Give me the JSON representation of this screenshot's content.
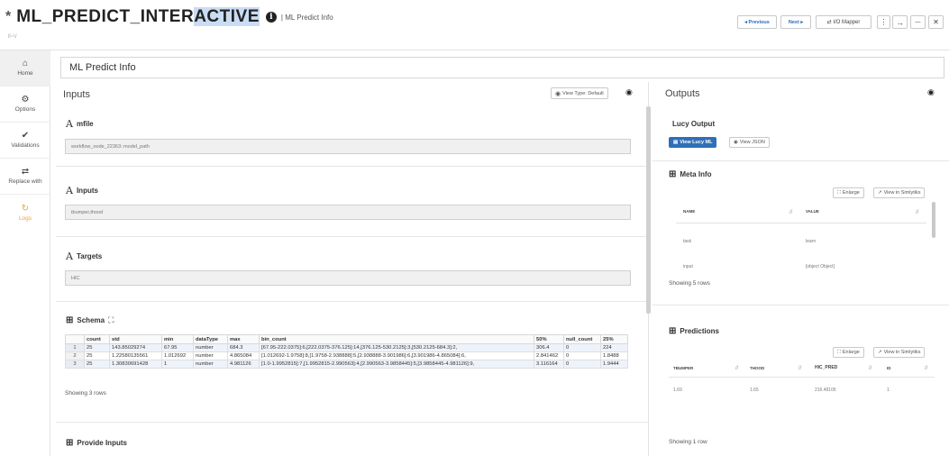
{
  "header": {
    "star": "*",
    "title_before": "ML_PREDICT_INTER",
    "title_highlight": "ACTIVE",
    "title_after": "",
    "info_icon": "info-circle-icon",
    "subtitle": "| ML Predict Info",
    "breadcrumb": "ll~\\/",
    "previous_label": "◂ Previous",
    "next_label": "Next ▸",
    "io_mapper_label": "⇄ I/O Mapper",
    "more_label": "⋮",
    "arrow_label": "→",
    "minimize_label": "—",
    "close_label": "✕"
  },
  "sidebar": {
    "items": [
      {
        "label": "Home",
        "icon": "⌂"
      },
      {
        "label": "Options",
        "icon": "⚙"
      },
      {
        "label": "Validations",
        "icon": "✔"
      },
      {
        "label": "Replace with",
        "icon": "⇄"
      },
      {
        "label": "Logs",
        "icon": "↻"
      }
    ]
  },
  "main": {
    "title": "ML Predict Info"
  },
  "inputs": {
    "heading": "Inputs",
    "view_type_label": "View Type: Default",
    "mfile": {
      "label": "mfile",
      "value": "workflow_node_22363::model_path"
    },
    "inputs": {
      "label": "Inputs",
      "value": "tbumper,thood"
    },
    "targets": {
      "label": "Targets",
      "value": "HIC"
    },
    "schema": {
      "label": "Schema",
      "columns": [
        "",
        "count",
        "std",
        "min",
        "dataType",
        "max",
        "bin_count",
        "50%",
        "null_count",
        "25%"
      ],
      "rows": [
        [
          "1",
          "25",
          "143.85029274",
          "67.95",
          "number",
          "684.3",
          "[67.95-222.0375]:6,[222.0375-376.125]:14,[376.125-530.2125]:3,[530.2125-684.3]:2,",
          "306.4",
          "0",
          "224"
        ],
        [
          "2",
          "25",
          "1.22580135561",
          "1.012692",
          "number",
          "4.865084",
          "[1.012692-1.9758]:8,[1.9758-2.938888]:5,[2.938888-3.901986]:6,[3.901986-4.865084]:6,",
          "2.841462",
          "0",
          "1.8488"
        ],
        [
          "3",
          "25",
          "1.30830691428",
          "1",
          "number",
          "4.981126",
          "[1.0-1.9952815]:7,[1.9952815-2.990563]:4,[2.990563-3.9858445]:5,[3.9858445-4.981126]:9,",
          "3.116164",
          "0",
          "1.9444"
        ]
      ],
      "footer": "Showing 3 rows"
    },
    "provide_inputs_label": "Provide Inputs"
  },
  "outputs": {
    "heading": "Outputs",
    "lucy_output_label": "Lucy Output",
    "view_lucy_ml_label": "View Lucy ML",
    "view_json_label": "View JSON",
    "meta_info": {
      "label": "Meta Info",
      "enlarge_label": "Enlarge",
      "view_simlytiks_label": "View in Simlytiks",
      "columns": [
        "NAME",
        "VALUE"
      ],
      "rows": [
        [
          "task",
          "learn"
        ],
        [
          "input",
          "[object Object]"
        ]
      ],
      "footer": "Showing 5 rows"
    },
    "predictions": {
      "label": "Predictions",
      "enlarge_label": "Enlarge",
      "view_simlytiks_label": "View in Simlytiks",
      "columns": [
        "TBUMPER",
        "THOOD",
        "HIC_PRED",
        "ID"
      ],
      "rows": [
        [
          "1.69",
          "1.65",
          "216.49105",
          "1"
        ]
      ],
      "footer": "Showing 1 row"
    }
  },
  "colors": {
    "accent": "#2f6fb7",
    "logs": "#e8a23a",
    "highlight": "#c9dcf3"
  }
}
